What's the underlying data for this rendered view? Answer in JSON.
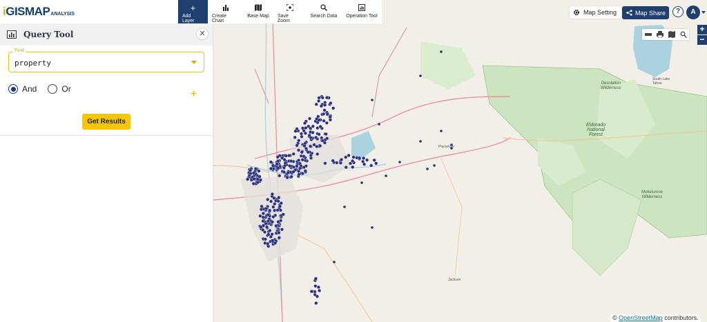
{
  "brand": {
    "name_prefix": "GISMAP",
    "name_suffix": "ANALYSIS"
  },
  "panel": {
    "title": "Query Tool",
    "find_label": "Find",
    "find_value": "property",
    "radio_and": "And",
    "radio_or": "Or",
    "selected": "And",
    "get_results": "Get Results"
  },
  "toolbar": [
    {
      "label": "Add Layer",
      "icon": "plus-icon",
      "active": true
    },
    {
      "label": "Create Chart",
      "icon": "bar-chart-icon"
    },
    {
      "label": "Base Map",
      "icon": "map-icon"
    },
    {
      "label": "Save Zoom",
      "icon": "focus-icon"
    },
    {
      "label": "Search Data",
      "icon": "search-icon"
    },
    {
      "label": "Operation Tool",
      "icon": "chart-box-icon"
    }
  ],
  "map_setting": "Map Setting",
  "map_share": "Map Share",
  "avatar_letter": "A",
  "attribution": {
    "prefix": "©",
    "link": "OpenStreetMap",
    "suffix": "contributors."
  },
  "map_labels": {
    "eldorado": "Eldorado\nNational\nForest",
    "desolation": "Desolation\nWilderness",
    "mokelumne": "Mokelumne\nWilderness",
    "south_lake": "South Lake\nTahoe",
    "jackson": "Jackson",
    "placerville": "Placerville"
  },
  "colors": {
    "accent": "#1f3f6e",
    "yellow": "#f7c600",
    "marker": "#2a2f7a"
  }
}
